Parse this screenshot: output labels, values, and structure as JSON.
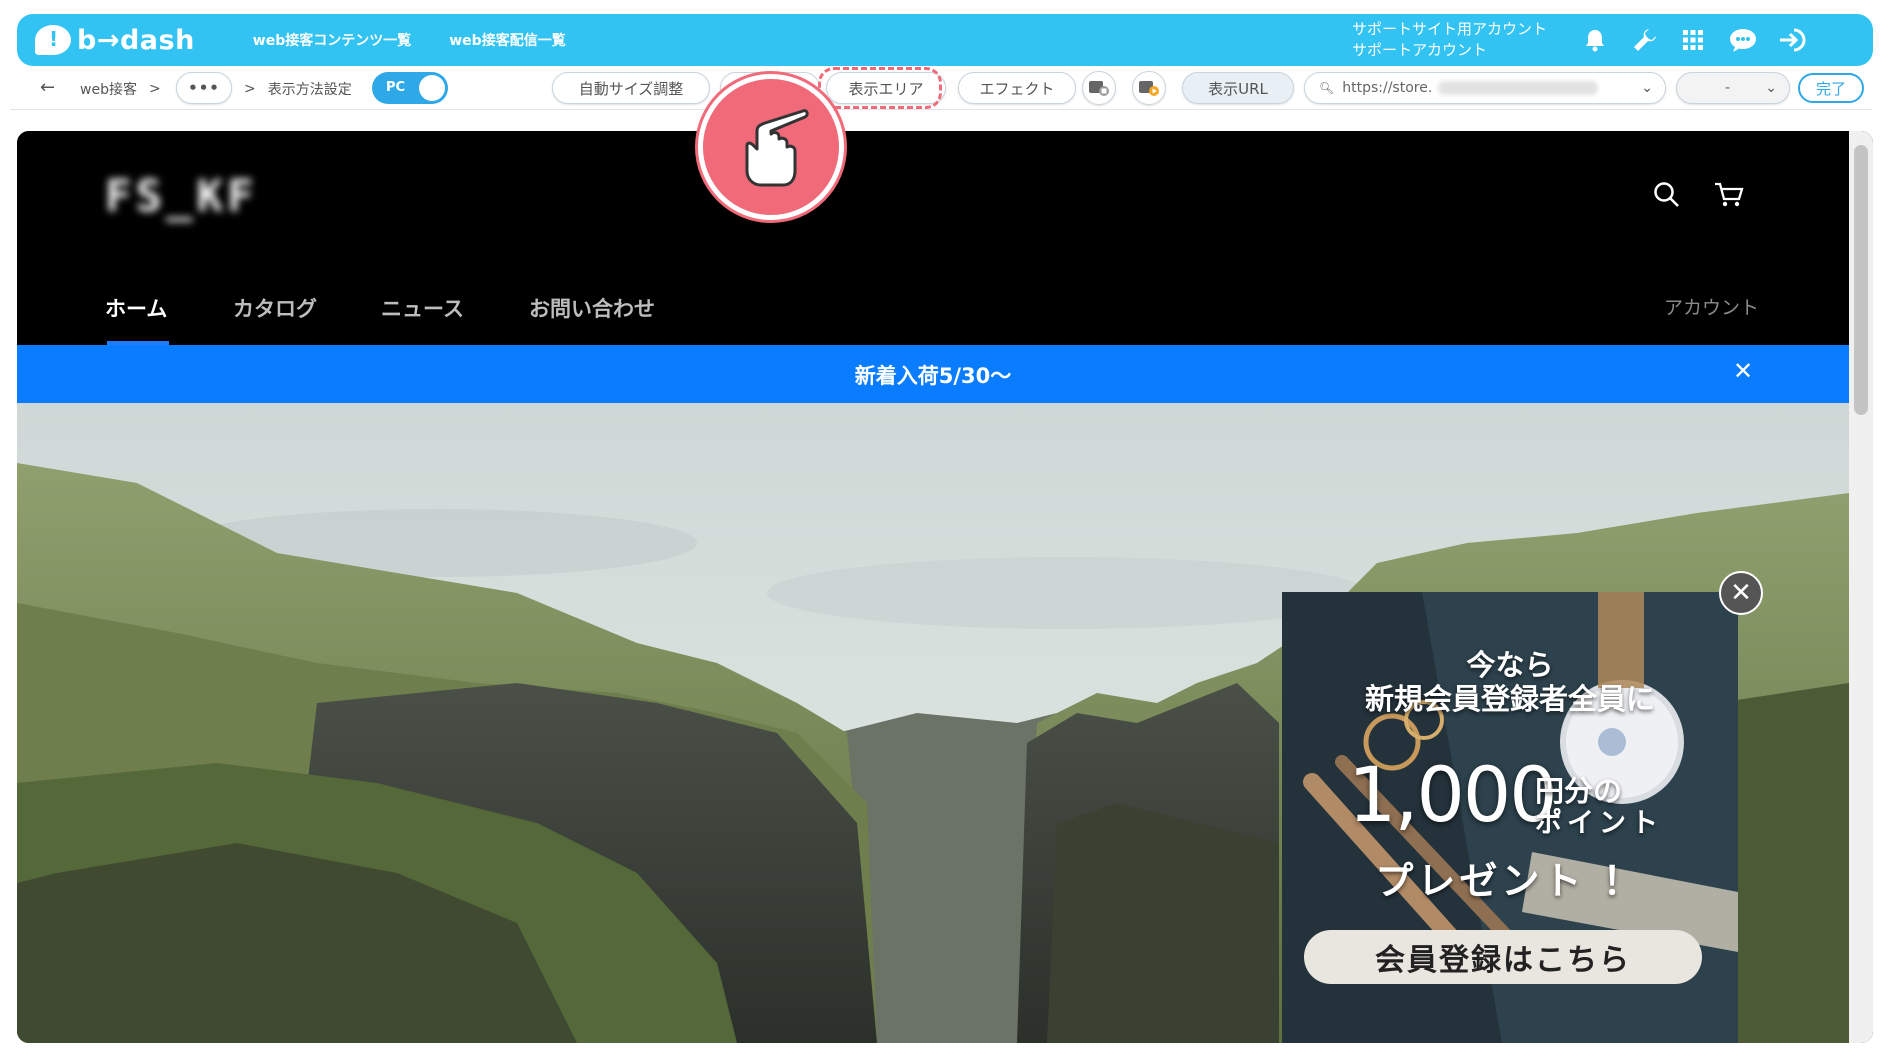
{
  "app": {
    "logo_text": "b→dash",
    "nav": [
      "web接客コンテンツ一覧",
      "web接客配信一覧"
    ],
    "account_line1": "サポートサイト用アカウント",
    "account_line2": "サポートアカウント",
    "icons": [
      "bell-icon",
      "wrench-icon",
      "grid-icon",
      "support-icon",
      "logout-icon"
    ],
    "brand_color": "#33c3f3"
  },
  "toolbar": {
    "breadcrumb_root": "web接客",
    "breadcrumb_sep": ">",
    "breadcrumb_more": "•••",
    "breadcrumb_current": "表示方法設定",
    "device_toggle_label": "PC",
    "buttons": {
      "auto_size": "自動サイズ調整",
      "display_area": "表示エリア",
      "effect": "エフェクト",
      "display_url": "表示URL"
    },
    "url_value": "https://store.",
    "select_value": "-",
    "done_label": "完了"
  },
  "site": {
    "logo": "FS_KF",
    "nav": [
      "ホーム",
      "カタログ",
      "ニュース",
      "お問い合わせ"
    ],
    "active_nav": "ホーム",
    "account_link": "アカウント",
    "announcement": "新着入荷5/30〜",
    "announcement_bg": "#0a7cff"
  },
  "popup": {
    "line1": "今なら",
    "line2": "新規会員登録者全員に",
    "amount": "1,000",
    "unit": "円分の",
    "points": "ポイント",
    "present": "プレゼント ！",
    "cta": "会員登録はこちら",
    "close": "✕"
  },
  "overlay": {
    "highlight_color": "#f06a7a"
  }
}
